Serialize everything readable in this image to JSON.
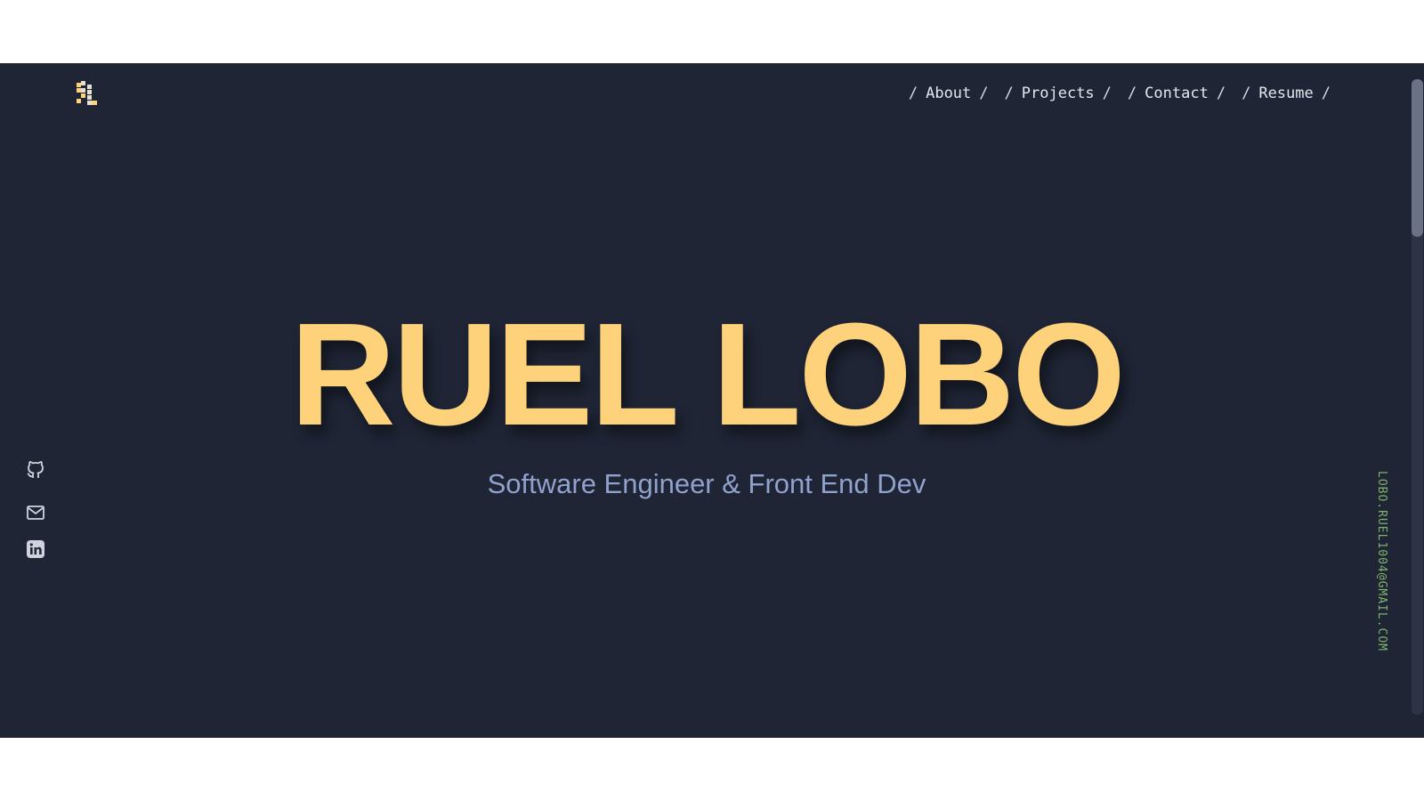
{
  "nav": {
    "items": [
      {
        "label": "About"
      },
      {
        "label": "Projects"
      },
      {
        "label": "Contact"
      },
      {
        "label": "Resume"
      }
    ],
    "separator": "/"
  },
  "hero": {
    "name": "RUEL LOBO",
    "subtitle": "Software Engineer & Front End Dev"
  },
  "social": {
    "icons": [
      "github-icon",
      "mail-icon",
      "linkedin-icon"
    ]
  },
  "sidebar_email": "LOBO.RUEL1004@GMAIL.COM",
  "colors": {
    "background": "#1f2535",
    "accent": "#fdd27a",
    "subtitle": "#8fa1cc",
    "email": "#7fb26b"
  }
}
